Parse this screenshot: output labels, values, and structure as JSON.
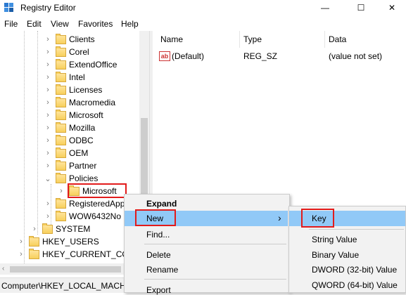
{
  "window": {
    "title": "Registry Editor",
    "minimize": "—",
    "maximize": "☐",
    "close": "✕"
  },
  "menubar": [
    "File",
    "Edit",
    "View",
    "Favorites",
    "Help"
  ],
  "tree": {
    "items": [
      {
        "label": "Clients"
      },
      {
        "label": "Corel"
      },
      {
        "label": "ExtendOffice"
      },
      {
        "label": "Intel"
      },
      {
        "label": "Licenses"
      },
      {
        "label": "Macromedia"
      },
      {
        "label": "Microsoft"
      },
      {
        "label": "Mozilla"
      },
      {
        "label": "ODBC"
      },
      {
        "label": "OEM"
      },
      {
        "label": "Partner"
      },
      {
        "label": "Policies"
      },
      {
        "label": "Microsoft",
        "selected": true
      },
      {
        "label": "RegisteredApp"
      },
      {
        "label": "WOW6432No"
      },
      {
        "label": "SYSTEM"
      },
      {
        "label": "HKEY_USERS"
      },
      {
        "label": "HKEY_CURRENT_COI"
      }
    ]
  },
  "list": {
    "columns": [
      "Name",
      "Type",
      "Data"
    ],
    "rows": [
      {
        "name": "(Default)",
        "type": "REG_SZ",
        "data": "(value not set)"
      }
    ]
  },
  "status": "Computer\\HKEY_LOCAL_MACH",
  "context_menu": {
    "items": [
      "Expand",
      "New",
      "Find...",
      "Delete",
      "Rename",
      "Export"
    ],
    "new_arrow": "›"
  },
  "submenu": {
    "items": [
      "Key",
      "String Value",
      "Binary Value",
      "DWORD (32-bit) Value",
      "QWORD (64-bit) Value"
    ]
  },
  "colors": {
    "highlight": "#91c9f7",
    "annotation_red": "#e21b1b",
    "folder": "#f7cf5c"
  }
}
